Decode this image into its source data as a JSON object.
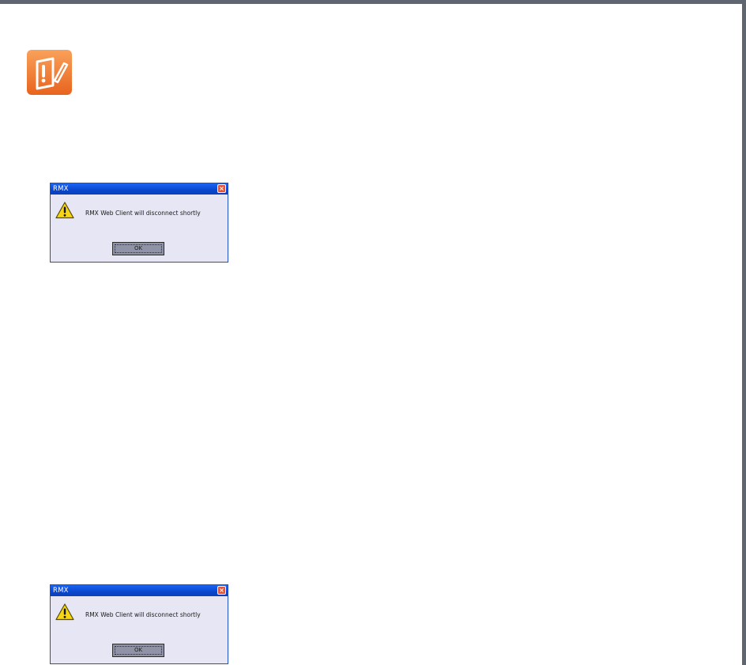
{
  "note_icon": {
    "name": "note-icon",
    "color": "#f07a30"
  },
  "dialogs": [
    {
      "title": "RMX",
      "message": "RMX Web Client will disconnect shortly",
      "ok_label": "OK",
      "close_glyph": "×",
      "icon": "warning-icon"
    },
    {
      "title": "RMX",
      "message": "RMX Web Client will disconnect shortly",
      "ok_label": "OK",
      "close_glyph": "×",
      "icon": "warning-icon"
    }
  ]
}
